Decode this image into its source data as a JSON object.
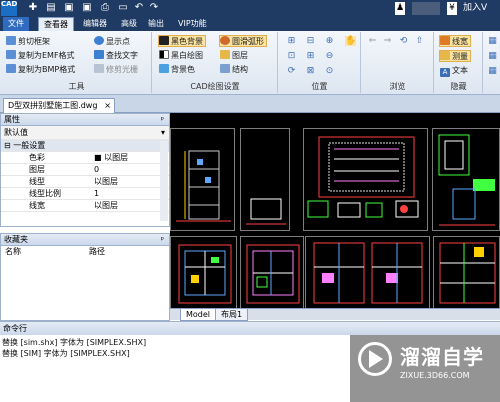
{
  "titlebar": {
    "logo": "CAD",
    "tray_user_icon": "user-icon",
    "tray_currency": "¥",
    "tray_join": "加入V"
  },
  "menubar": {
    "items": [
      "文件",
      "查看器",
      "编辑器",
      "高级",
      "输出",
      "VIP功能"
    ]
  },
  "ribbon": {
    "tools": {
      "title": "工具",
      "buttons": [
        "剪切框架",
        "复制为EMF格式",
        "复制为BMP格式",
        "显示点",
        "查找文字",
        "修剪光栅"
      ]
    },
    "cad_settings": {
      "title": "CAD绘图设置",
      "buttons": [
        "黑色背景",
        "黑白绘图",
        "背景色",
        "圆滑弧形",
        "图层",
        "结构"
      ]
    },
    "position": {
      "title": "位置"
    },
    "browse": {
      "title": "浏览"
    },
    "hide": {
      "title": "隐藏",
      "buttons": [
        "线宽",
        "测量",
        "文本"
      ]
    }
  },
  "file_tab": {
    "name": "D型双拼别墅施工图.dwg"
  },
  "properties": {
    "title": "属性",
    "default_value": "默认值",
    "section": "一般设置",
    "rows": [
      {
        "key": "色彩",
        "value": "■ 以图层"
      },
      {
        "key": "图层",
        "value": "0"
      },
      {
        "key": "线型",
        "value": "以图层"
      },
      {
        "key": "线型比例",
        "value": "1"
      },
      {
        "key": "线宽",
        "value": "以图层"
      }
    ]
  },
  "favorites": {
    "title": "收藏夹",
    "col_name": "名称",
    "col_path": "路径"
  },
  "layout_tabs": [
    "Model",
    "布局1"
  ],
  "command": {
    "title": "命令行",
    "lines": [
      "替换 [sim.shx] 字体为 [SIMPLEX.SHX]",
      "替换 [SIM] 字体为 [SIMPLEX.SHX]"
    ]
  },
  "watermark": {
    "name": "溜溜自学",
    "url": "ZIXUE.3D66.COM"
  },
  "colors": {
    "titlebar": "#1f3b63",
    "canvas": "#000000",
    "ribbon_selected": "#fbe3a0"
  }
}
